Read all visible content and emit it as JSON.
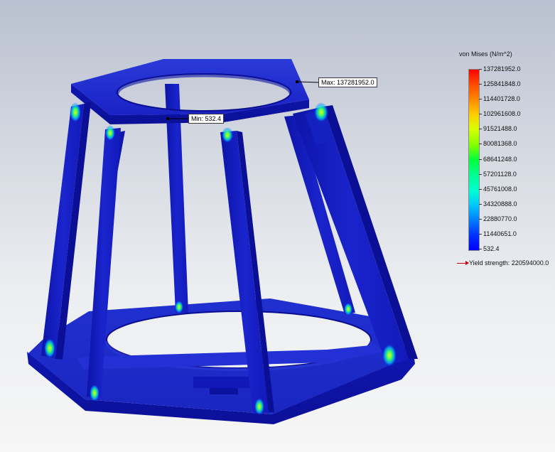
{
  "plot": {
    "min_label": "Min: 532.4",
    "max_label": "Max: 137281952.0"
  },
  "legend": {
    "title": "von Mises (N/m^2)",
    "ticks": [
      "137281952.0",
      "125841848.0",
      "114401728.0",
      "102961608.0",
      "91521488.0",
      "80081368.0",
      "68641248.0",
      "57201128.0",
      "45761008.0",
      "34320888.0",
      "22880770.0",
      "11440651.0",
      "532.4"
    ],
    "yield_label": "Yield strength: 220594000.0"
  },
  "colors": {
    "structure_blue": "#1515d0",
    "scale_max": "#ff0000",
    "scale_min": "#0000ff",
    "yield_arrow": "#cc0000"
  }
}
